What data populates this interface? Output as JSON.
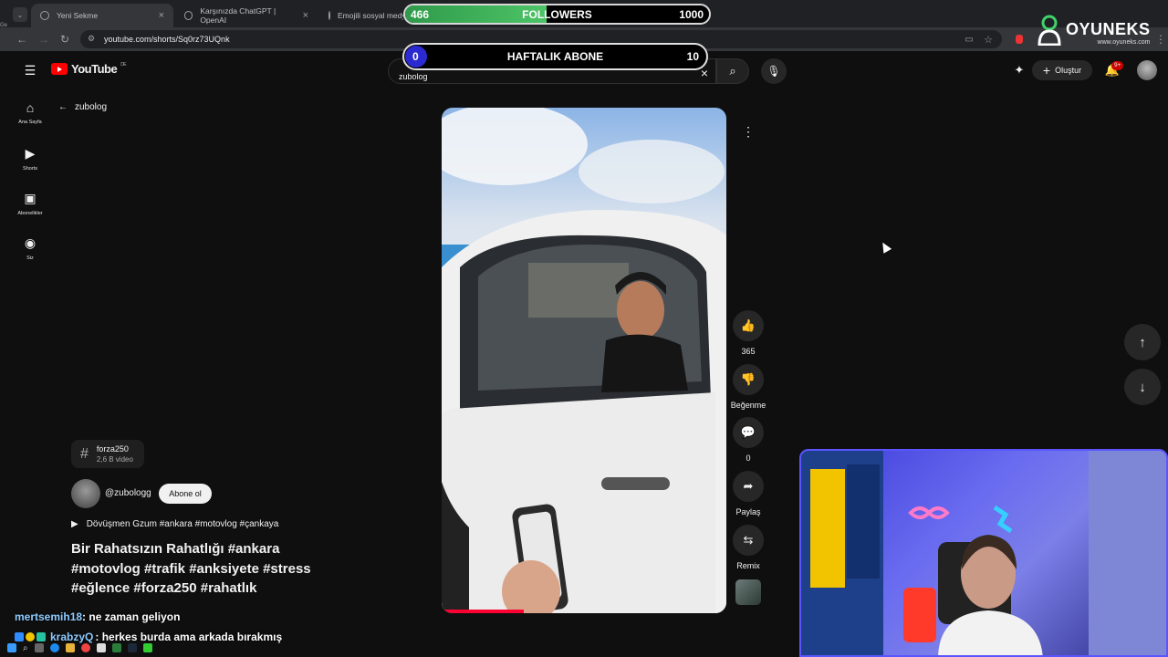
{
  "browser": {
    "tabs": [
      {
        "label": "Yeni Sekme"
      },
      {
        "label": "Karşınızda ChatGPT | OpenAI"
      },
      {
        "label": "Emojili sosyal medya"
      }
    ],
    "new_tab": "+",
    "url": "youtube.com/shorts/Sq0rz73UQnk"
  },
  "youtube": {
    "logo": "YouTube",
    "region": "DE",
    "search_value": "zubolog",
    "create_label": "Oluştur",
    "notification_badge": "9+",
    "sidebar": [
      {
        "label": "Ana Sayfa",
        "icon": "home-icon"
      },
      {
        "label": "Shorts",
        "icon": "shorts-icon"
      },
      {
        "label": "Abonelikler",
        "icon": "subscriptions-icon"
      },
      {
        "label": "Siz",
        "icon": "account-icon"
      }
    ],
    "back_label": "zubolog",
    "hashtag": {
      "name": "forza250",
      "count": "2,6 B video"
    },
    "channel": {
      "handle": "@zubologg",
      "subscribe": "Abone ol"
    },
    "music": "Dövüşmen Gzum #ankara #motovlog #çankaya",
    "title": "Bir Rahatsızın Rahatlığı #ankara #motovlog #trafik #anksiyete #stress #eğlence #forza250 #rahatlık",
    "actions": {
      "likes": "365",
      "dislike": "Beğenme",
      "comments": "0",
      "share": "Paylaş",
      "remix": "Remix"
    }
  },
  "overlay": {
    "followers": {
      "label": "FOLLOWERS",
      "current": "466",
      "goal": "1000",
      "progress": 0.466
    },
    "haftalik": {
      "label": "HAFTALIK ABONE",
      "current": "0",
      "goal": "10",
      "progress": 0.0
    },
    "brand": {
      "name": "OYUNEKS",
      "site": "www.oyuneks.com"
    }
  },
  "chat": [
    {
      "user": "mertsemih18",
      "text": ": ne zaman geliyon"
    },
    {
      "user": "krabzyQ",
      "text": ": herkes burda ama arkada bırakmış"
    }
  ],
  "colors": {
    "youtube_red": "#ff0000",
    "followers_green": "#4dc467",
    "haftalik_blue": "#2a2ad0"
  }
}
